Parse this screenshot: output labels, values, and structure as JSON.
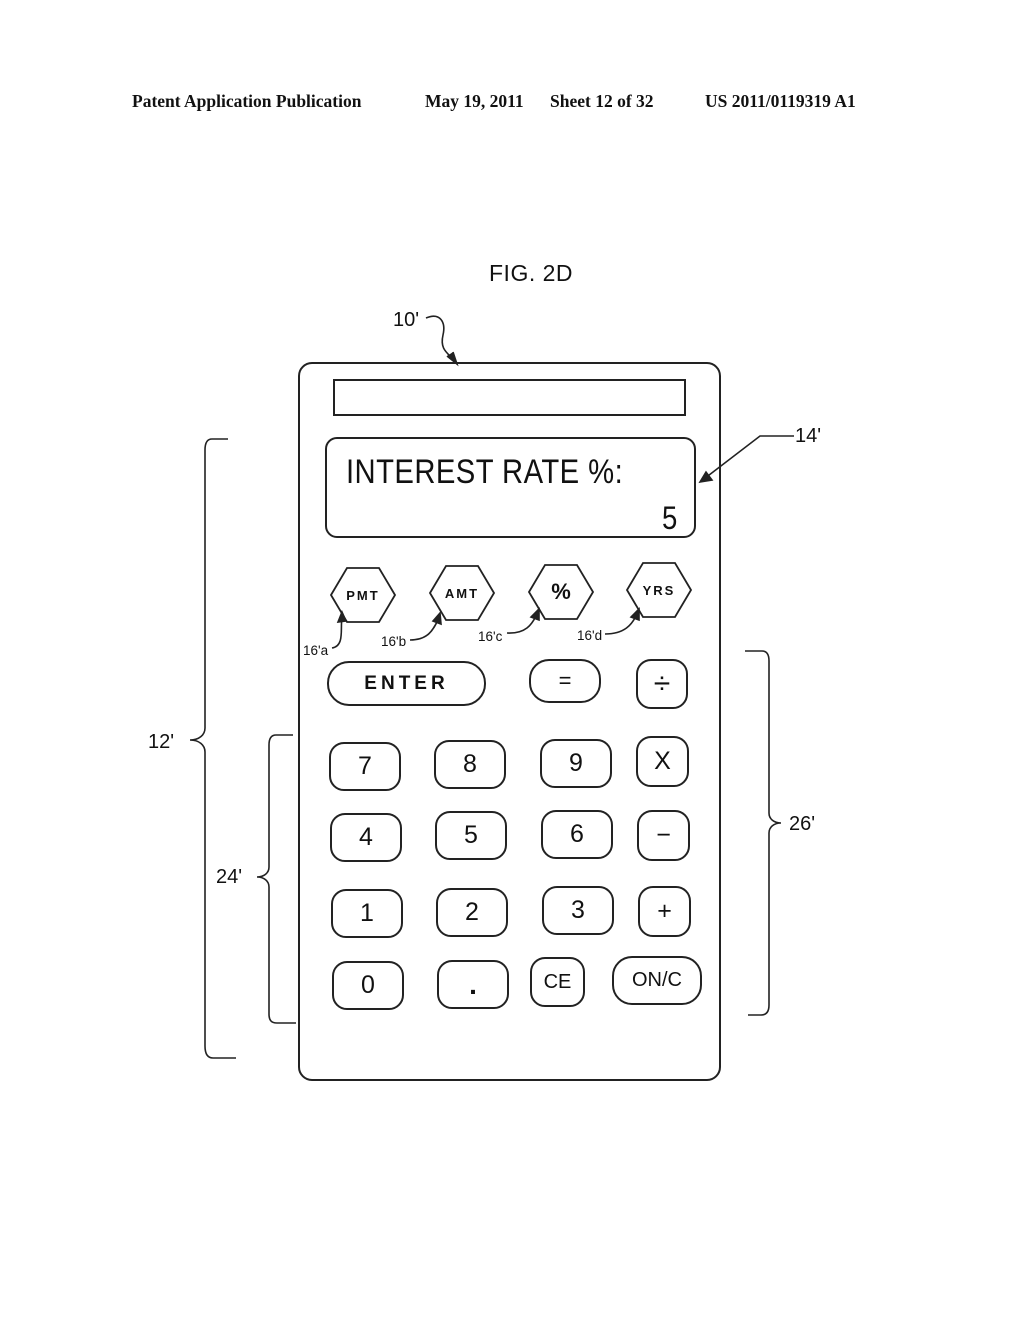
{
  "header": {
    "publication": "Patent Application Publication",
    "date": "May 19, 2011",
    "sheet": "Sheet 12 of 32",
    "number": "US 2011/0119319 A1"
  },
  "figure": {
    "title": "FIG. 2D",
    "refs": {
      "device": "10'",
      "keypad_region": "12'",
      "display": "14'",
      "function_key_a": "16'a",
      "function_key_b": "16'b",
      "function_key_c": "16'c",
      "function_key_d": "16'd",
      "numeric_keys": "24'",
      "operator_keys": "26'"
    },
    "display": {
      "label": "INTEREST RATE %:",
      "value": "5"
    },
    "function_keys": [
      "PMT",
      "AMT",
      "%",
      "YRS"
    ],
    "keys": {
      "enter": "ENTER",
      "equals": "=",
      "divide": "÷",
      "seven": "7",
      "eight": "8",
      "nine": "9",
      "multiply": "X",
      "four": "4",
      "five": "5",
      "six": "6",
      "minus": "−",
      "one": "1",
      "two": "2",
      "three": "3",
      "plus": "+",
      "zero": "0",
      "decimal": ".",
      "clear_entry": "CE",
      "on_clear": "ON/C"
    }
  }
}
